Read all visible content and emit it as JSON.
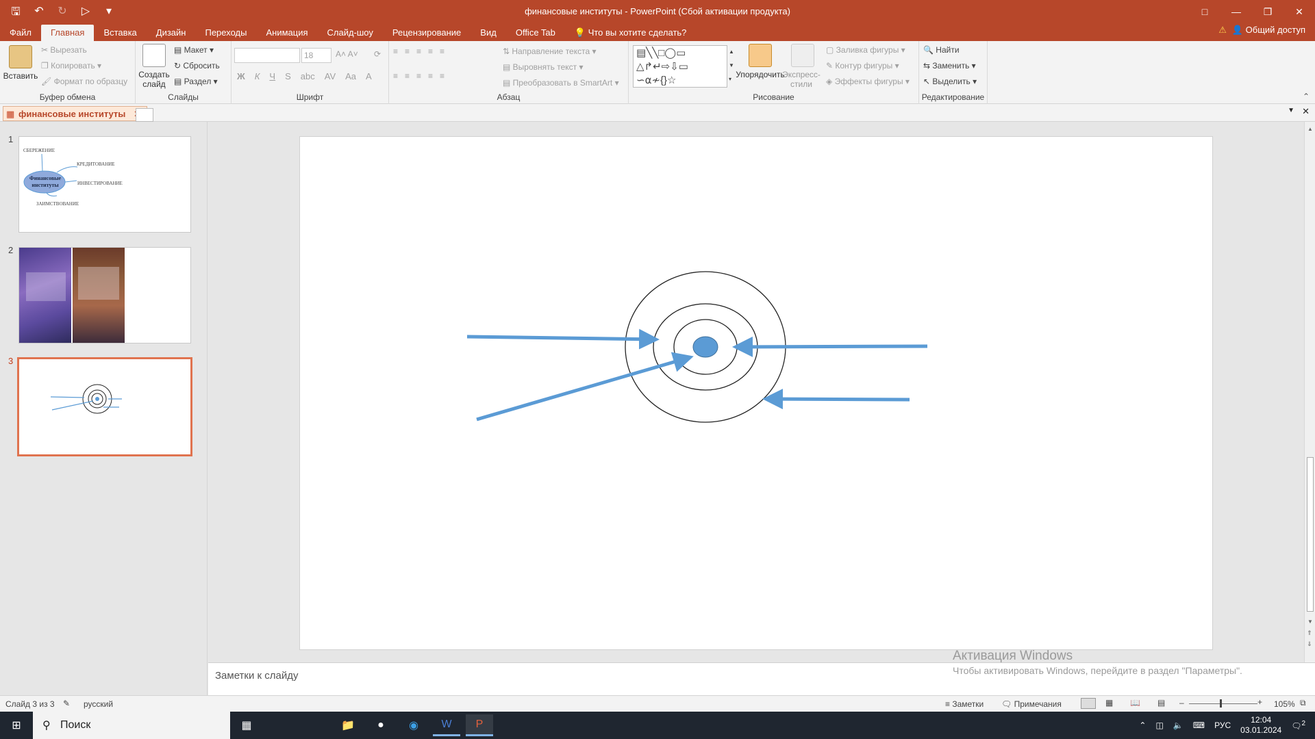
{
  "titlebar": {
    "title": "финансовые институты - PowerPoint (Сбой активации продукта)"
  },
  "tabs": [
    "Файл",
    "Главная",
    "Вставка",
    "Дизайн",
    "Переходы",
    "Анимация",
    "Слайд-шоу",
    "Рецензирование",
    "Вид",
    "Office Tab"
  ],
  "active_tab": "Главная",
  "tellme": "Что вы хотите сделать?",
  "share": "Общий доступ",
  "ribbon": {
    "clipboard": {
      "label": "Буфер обмена",
      "paste": "Вставить",
      "cut": "Вырезать",
      "copy": "Копировать",
      "format": "Формат по образцу"
    },
    "slides": {
      "label": "Слайды",
      "new": "Создать слайд",
      "layout": "Макет",
      "reset": "Сбросить",
      "section": "Раздел"
    },
    "font": {
      "label": "Шрифт",
      "size": "18",
      "b": "Ж",
      "i": "К",
      "u": "Ч",
      "s": "S",
      "strike": "abc",
      "aa": "Aa",
      "color_a": "A"
    },
    "paragraph": {
      "label": "Абзац",
      "direction": "Направление текста",
      "align": "Выровнять текст",
      "smartart": "Преобразовать в SmartArt"
    },
    "drawing": {
      "label": "Рисование",
      "arrange": "Упорядочить",
      "styles": "Экспресс-стили",
      "fill": "Заливка фигуры",
      "outline": "Контур фигуры",
      "effects": "Эффекты фигуры"
    },
    "editing": {
      "label": "Редактирование",
      "find": "Найти",
      "replace": "Заменить",
      "select": "Выделить"
    }
  },
  "doctab": "финансовые институты",
  "slides_panel": [
    {
      "num": "1",
      "title": "Финансовые институты",
      "items": [
        "СБЕРЕЖЕНИЕ",
        "КРЕДИТОВАНИЕ",
        "ИНВЕСТИРОВАНИЕ",
        "ЗАИМСТВОВАНИЕ"
      ]
    },
    {
      "num": "2"
    },
    {
      "num": "3",
      "active": true
    }
  ],
  "notes_placeholder": "Заметки к слайду",
  "watermark": {
    "line1": "Активация Windows",
    "line2": "Чтобы активировать Windows, перейдите в раздел \"Параметры\"."
  },
  "status": {
    "slide": "Слайд 3 из 3",
    "lang": "русский",
    "notes": "Заметки",
    "comments": "Примечания",
    "zoom": "105%"
  },
  "taskbar": {
    "search": "Поиск",
    "lang": "РУС",
    "time": "12:04",
    "date": "03.01.2024",
    "notif": "2"
  },
  "colors": {
    "accent": "#b7472a",
    "shape": "#5b9bd5"
  }
}
